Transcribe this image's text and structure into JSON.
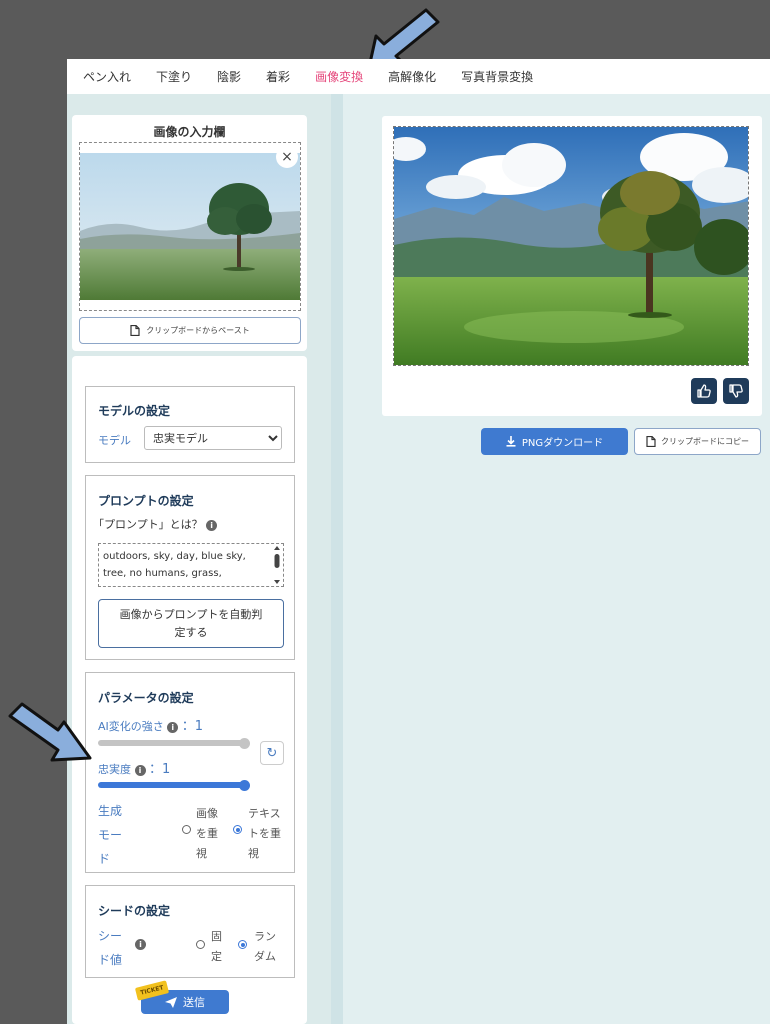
{
  "tabs": [
    {
      "label": "ペン入れ"
    },
    {
      "label": "下塗り"
    },
    {
      "label": "陰影"
    },
    {
      "label": "着彩"
    },
    {
      "label": "画像変換",
      "active": true
    },
    {
      "label": "高解像化"
    },
    {
      "label": "写真背景変換"
    }
  ],
  "input_panel": {
    "title": "画像の入力欄",
    "close_icon": "×",
    "paste_label": "クリップボードからペースト"
  },
  "model_section": {
    "title": "モデルの設定",
    "label": "モデル",
    "selected": "忠実モデル"
  },
  "prompt_section": {
    "title": "プロンプトの設定",
    "help_label": "「プロンプト」とは？",
    "prompt_text": "outdoors, sky, day, blue sky, tree, no humans, grass,",
    "auto_button": "画像からプロンプトを自動判定する"
  },
  "parameter_section": {
    "title": "パラメータの設定",
    "ai_strength_label": "AI変化の強さ",
    "ai_strength_value": "：1",
    "ai_strength_level": 1,
    "fidelity_label": "忠実度",
    "fidelity_value": "：1",
    "fidelity_level": 1,
    "mode_label_lines": [
      "生成",
      "モー",
      "ド"
    ],
    "mode_option_image_lines": [
      "画像",
      "を重",
      "視"
    ],
    "mode_option_text_lines": [
      "テキス",
      "トを重",
      "視"
    ],
    "mode_selected": "text"
  },
  "seed_section": {
    "title": "シードの設定",
    "label_lines": [
      "シー",
      "ド値"
    ],
    "option_fixed_lines": [
      "固",
      "定"
    ],
    "option_random_lines": [
      "ラン",
      "ダム"
    ],
    "selected": "random"
  },
  "send": {
    "label": "送信",
    "ticket": "TICKET"
  },
  "output": {
    "download_label": "PNGダウンロード",
    "copy_label": "クリップボードにコピー"
  },
  "colors": {
    "accent": "#3f7ad0",
    "active_tab": "#e5457a",
    "navy": "#1f3b5a",
    "annotation_arrow": "#8aaedc"
  }
}
